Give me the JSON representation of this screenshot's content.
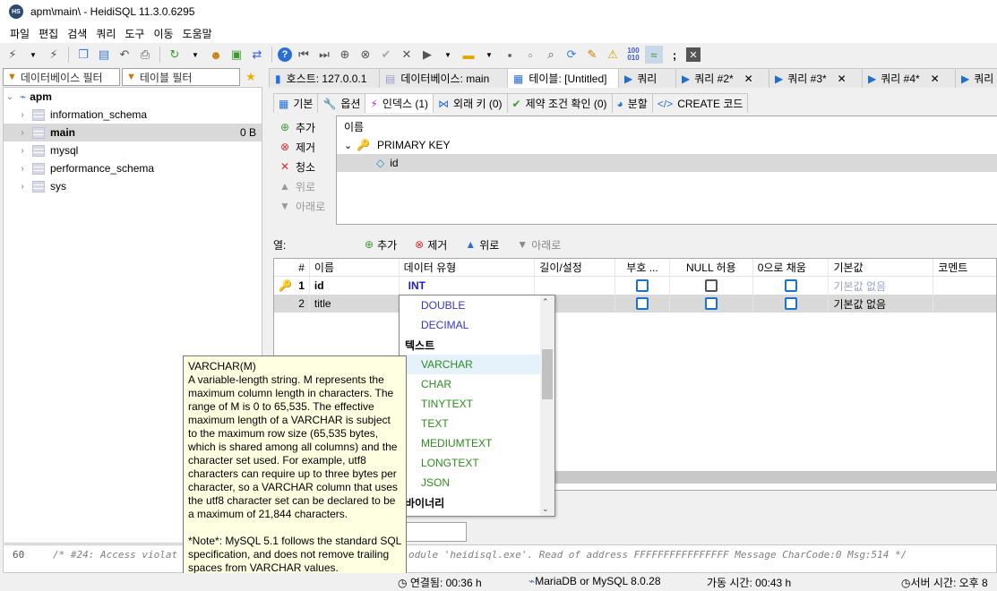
{
  "window": {
    "title": "apm\\main\\ - HeidiSQL 11.3.0.6295",
    "app_icon": "HS"
  },
  "menu": [
    "파일",
    "편집",
    "검색",
    "쿼리",
    "도구",
    "이동",
    "도움말"
  ],
  "filters": {
    "database_filter": "데이터베이스 필터",
    "table_filter": "테이블 필터"
  },
  "tree": {
    "root": "apm",
    "items": [
      {
        "name": "information_schema",
        "size": ""
      },
      {
        "name": "main",
        "size": "0 B"
      },
      {
        "name": "mysql",
        "size": ""
      },
      {
        "name": "performance_schema",
        "size": ""
      },
      {
        "name": "sys",
        "size": ""
      }
    ]
  },
  "tabs": [
    {
      "label": "호스트: 127.0.0.1"
    },
    {
      "label": "데이터베이스: main"
    },
    {
      "label": "테이블: [Untitled]"
    },
    {
      "label": "쿼리"
    },
    {
      "label": "쿼리 #2*"
    },
    {
      "label": "쿼리 #3*"
    },
    {
      "label": "쿼리 #4*"
    },
    {
      "label": "쿼리"
    }
  ],
  "subtabs": [
    "기본",
    "옵션",
    "인덱스 (1)",
    "외래 키 (0)",
    "제약 조건 확인 (0)",
    "분할",
    "CREATE 코드"
  ],
  "index_actions": [
    "추가",
    "제거",
    "청소",
    "위로",
    "아래로"
  ],
  "index_tree": {
    "header": "이름",
    "key": "PRIMARY KEY",
    "column": "id"
  },
  "columns_bar": {
    "label": "열:",
    "add": "추가",
    "remove": "제거",
    "up": "위로",
    "down": "아래로"
  },
  "grid": {
    "headers": [
      "#",
      "이름",
      "데이터 유형",
      "길이/설정",
      "부호 ...",
      "NULL 허용",
      "0으로 채움",
      "기본값",
      "코멘트"
    ],
    "rows": [
      {
        "num": "1",
        "name": "id",
        "type": "INT",
        "default": "기본값 없음"
      },
      {
        "num": "2",
        "name": "title",
        "type": "",
        "default": "기본값 없음"
      }
    ]
  },
  "dropdown": [
    {
      "label": "DOUBLE",
      "kind": "blue"
    },
    {
      "label": "DECIMAL",
      "kind": "blue"
    },
    {
      "label": "텍스트",
      "kind": "grp"
    },
    {
      "label": "VARCHAR",
      "kind": "green hover"
    },
    {
      "label": "CHAR",
      "kind": "green"
    },
    {
      "label": "TINYTEXT",
      "kind": "green"
    },
    {
      "label": "TEXT",
      "kind": "green"
    },
    {
      "label": "MEDIUMTEXT",
      "kind": "green"
    },
    {
      "label": "LONGTEXT",
      "kind": "green"
    },
    {
      "label": "JSON",
      "kind": "green"
    },
    {
      "label": "바이너리",
      "kind": "grp"
    }
  ],
  "tooltip": {
    "title": "VARCHAR(M)",
    "body": "A variable-length string. M represents the maximum column length in characters. The range of M is 0 to 65,535. The effective maximum length of a VARCHAR is subject to the maximum row size (65,535 bytes, which is shared among all columns) and the character set used. For example, utf8 characters can require up to three bytes per character, so a VARCHAR column that uses the utf8 character set can be declared to be a maximum of 21,844 characters.",
    "note": "*Note*: MySQL 5.1 follows the standard SQL specification, and does not remove trailing spaces from VARCHAR values."
  },
  "log": {
    "line_num": "60",
    "text_left": "/* #24: Access violat",
    "text_right": "odule 'heidisql.exe'. Read of address FFFFFFFFFFFFFFFF Message CharCode:0 Msg:514 */"
  },
  "status": {
    "connected": "연결됨: 00:36 h",
    "server": "MariaDB or MySQL 8.0.28",
    "uptime": "가동 시간: 00:43 h",
    "server_time": "서버 시간: 오후 8"
  }
}
